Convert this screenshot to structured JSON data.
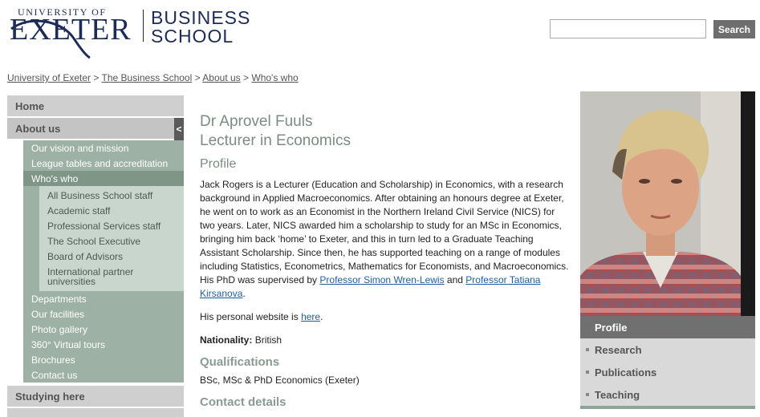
{
  "header": {
    "logo_university": "UNIVERSITY OF",
    "logo_exeter": "EXETER",
    "logo_business": "BUSINESS",
    "logo_school": "SCHOOL",
    "search_placeholder": "",
    "search_button": "Search"
  },
  "breadcrumb": {
    "items": [
      "University of Exeter",
      "The Business School",
      "About us",
      "Who's who"
    ],
    "separator": ">"
  },
  "nav": {
    "home": "Home",
    "about": "About us",
    "collapse_glyph": "<",
    "about_sub": [
      "Our vision and mission",
      "League tables and accreditation",
      "Who's who"
    ],
    "whos_who_sub": [
      "All Business School staff",
      "Academic staff",
      "Professional Services staff",
      "The School Executive",
      "Board of Advisors",
      "International partner universities"
    ],
    "about_sub_more": [
      "Departments",
      "Our facilities",
      "Photo gallery",
      "360° Virtual tours",
      "Brochures",
      "Contact us"
    ],
    "studying": "Studying here"
  },
  "profile": {
    "name": "Dr Aprovel Fuuls",
    "title": "Lecturer in Economics",
    "profile_heading": "Profile",
    "bio_text": "Jack Rogers is a Lecturer (Education and Scholarship) in Economics, with a research background in Applied Macroeconomics. After obtaining an honours degree at Exeter, he went on to work as an Economist in the Northern Ireland Civil Service (NICS) for two years. Later, NICS awarded him a scholarship to study for an MSc in Economics, bringing him back ‘home’ to Exeter, and this in turn led to a Graduate Teaching Assistant Scholarship. Since then, he has supported teaching on a range of modules including Statistics, Econometrics, Mathematics for Economists, and Macroeconomics. His PhD was supervised by",
    "link_1": "Professor Simon Wren-Lewis",
    "and_text": "and",
    "link_2": "Professor Tatiana Kirsanova",
    "end_period": ".",
    "website_text": "His personal website is",
    "website_link": "here",
    "nationality_label": "Nationality:",
    "nationality_value": "British",
    "qualifications_heading": "Qualifications",
    "qualifications_value": "BSc, MSc & PhD Economics (Exeter)",
    "contact_heading": "Contact details"
  },
  "side_tabs": {
    "items": [
      "Profile",
      "Research",
      "Publications",
      "Teaching"
    ],
    "active": "Profile"
  },
  "colors": {
    "brand_navy": "#1d2b57",
    "nav_green": "#9eb1a5",
    "nav_green_active": "#7f9687",
    "nav_green_light": "#c8d6cd",
    "heading_green": "#7b8c82",
    "link_blue": "#1f5fa0"
  }
}
